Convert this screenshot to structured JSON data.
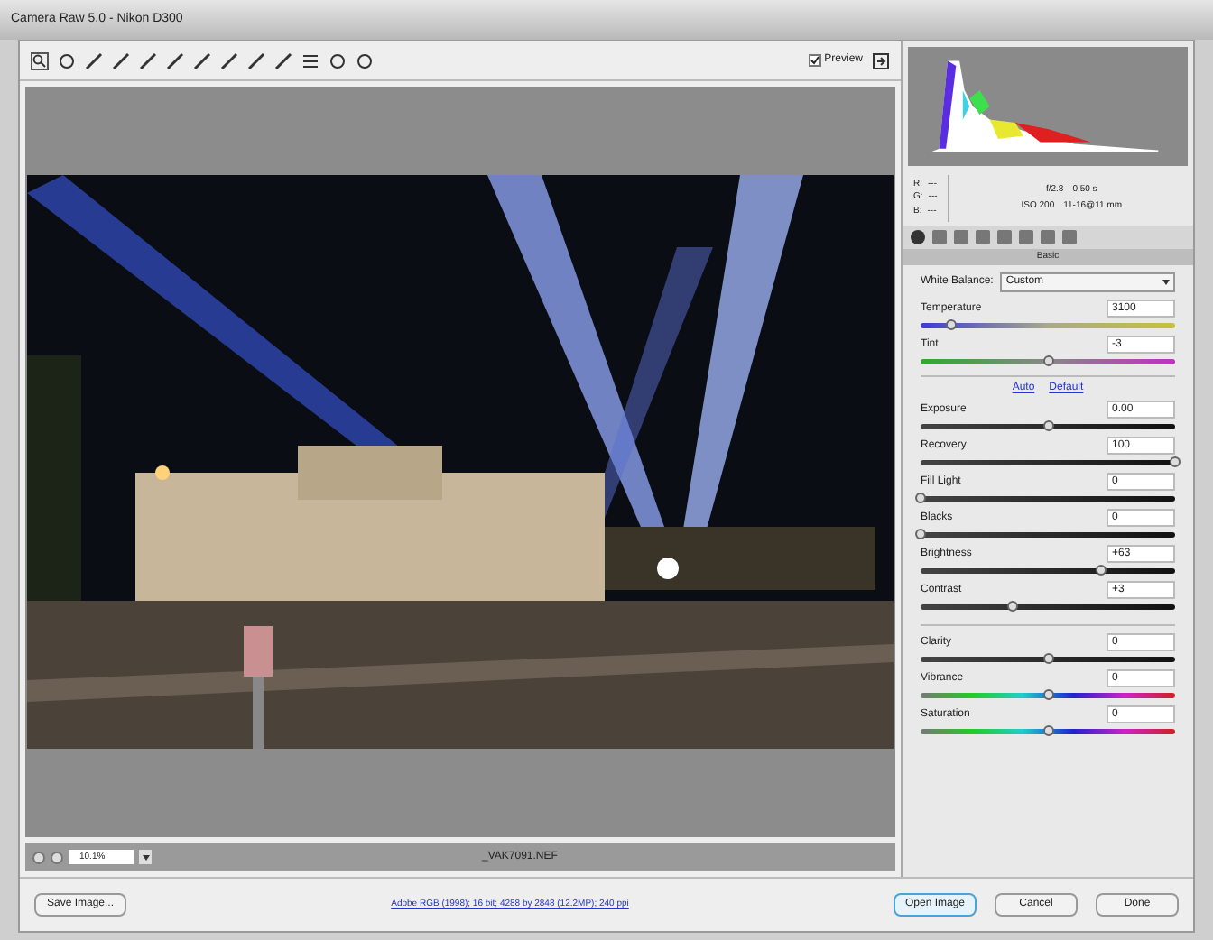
{
  "window": {
    "title": "Camera Raw 5.0  -  Nikon D300"
  },
  "toolbar": {
    "preview": {
      "label": "Preview",
      "checked": true
    }
  },
  "info": {
    "rgb": [
      {
        "label": "R:",
        "value": "---"
      },
      {
        "label": "G:",
        "value": "---"
      },
      {
        "label": "B:",
        "value": "---"
      }
    ],
    "aperture": "f/2.8",
    "shutter": "0.50 s",
    "iso": "ISO 200",
    "lens": "11-16@11 mm"
  },
  "panel": {
    "title": "Basic",
    "white_balance": {
      "label": "White Balance:",
      "value": "Custom"
    },
    "wb_sliders": [
      {
        "label": "Temperature",
        "value": "3100",
        "level": 0.12,
        "kind": "temperature"
      },
      {
        "label": "Tint",
        "value": "-3",
        "level": 0.5,
        "kind": "tint"
      }
    ],
    "links": [
      "Auto",
      "Default"
    ],
    "tone_sliders": [
      {
        "label": "Exposure",
        "value": "0.00",
        "level": 0.5,
        "kind": "gray"
      },
      {
        "label": "Recovery",
        "value": "100",
        "level": 1,
        "kind": "gray"
      },
      {
        "label": "Fill Light",
        "value": "0",
        "level": 0,
        "kind": "gray"
      },
      {
        "label": "Blacks",
        "value": "0",
        "level": 0,
        "kind": "gray"
      },
      {
        "label": "Brightness",
        "value": "+63",
        "level": 0.71,
        "kind": "gray"
      },
      {
        "label": "Contrast",
        "value": "+3",
        "level": 0.36,
        "kind": "gray"
      }
    ],
    "presence_sliders": [
      {
        "label": "Clarity",
        "value": "0",
        "level": 0.5,
        "kind": "gray"
      },
      {
        "label": "Vibrance",
        "value": "0",
        "level": 0.5,
        "kind": "color"
      },
      {
        "label": "Saturation",
        "value": "0",
        "level": 0.5,
        "kind": "color"
      }
    ]
  },
  "status": {
    "zoom": "10.1%",
    "filename": "_VAK7091.NEF"
  },
  "footer": {
    "save": "Save Image...",
    "workflow": "Adobe RGB (1998); 16 bit; 4288 by 2848 (12.2MP); 240 ppi",
    "buttons": [
      "Open Image",
      "Cancel",
      "Done"
    ]
  }
}
